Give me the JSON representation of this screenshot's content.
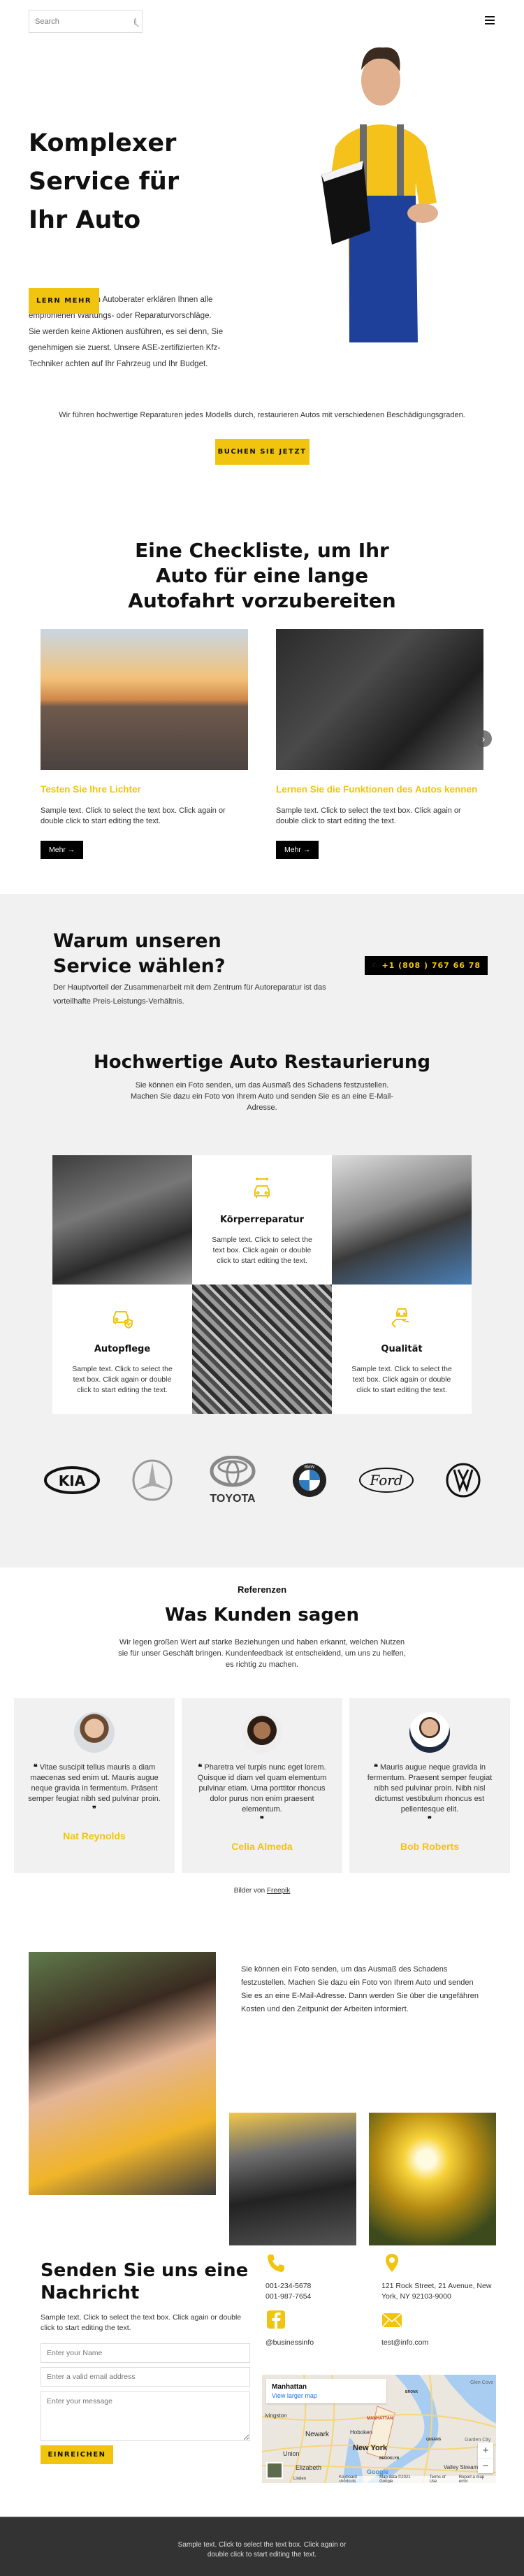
{
  "header": {
    "search_placeholder": "Search",
    "search_icon": "search-icon",
    "menu_icon": "hamburger-icon"
  },
  "hero": {
    "title": "Komplexer Service für Ihr Auto",
    "description": "Unsere freundlichen Autoberater erklären Ihnen alle empfohlenen Wartungs- oder Reparaturvorschläge. Sie werden keine Aktionen ausführen, es sei denn, Sie genehmigen sie zuerst. Unsere ASE-zertifizierten Kfz-Techniker achten auf Ihr Fahrzeug und Ihr Budget.",
    "button": "LERN MEHR"
  },
  "intro": {
    "text": "Wir führen hochwertige Reparaturen jedes Modells durch, restaurieren Autos mit verschiedenen Beschädigungsgraden.",
    "button": "BUCHEN SIE JETZT"
  },
  "checklist": {
    "title": "Eine Checkliste, um Ihr Auto für eine lange Autofahrt vorzubereiten",
    "cards": [
      {
        "title": "Testen Sie Ihre Lichter",
        "text": "Sample text. Click to select the text box. Click again or double click to start editing the text.",
        "button": "Mehr →"
      },
      {
        "title": "Lernen Sie die Funktionen des Autos kennen",
        "text": "Sample text. Click to select the text box. Click again or double click to start editing the text.",
        "button": "Mehr →"
      }
    ],
    "next_icon": "chevron-right-icon"
  },
  "why": {
    "title": "Warum unseren Service wählen?",
    "text": "Der Hauptvorteil der Zusammenarbeit mit dem Zentrum für Autoreparatur ist das vorteilhafte Preis-Leistungs-Verhältnis.",
    "phone": "+1 (808 ) 767 66 78"
  },
  "restoration": {
    "title": "Hochwertige Auto Restaurierung",
    "subtitle": "Sie können ein Foto senden, um das Ausmaß des Schadens festzustellen. Machen Sie dazu ein Foto von Ihrem Auto und senden Sie es an eine E-Mail-Adresse.",
    "features": [
      {
        "title": "Körperreparatur",
        "text": "Sample text. Click to select the text box. Click again or double click to start editing the text.",
        "icon": "car-wrench-icon"
      },
      {
        "title": "Autopflege",
        "text": "Sample text. Click to select the text box. Click again or double click to start editing the text.",
        "icon": "car-shield-icon"
      },
      {
        "title": "Qualität",
        "text": "Sample text. Click to select the text box. Click again or double click to start editing the text.",
        "icon": "hand-car-icon"
      }
    ]
  },
  "brands": [
    "KIA",
    "Mercedes-Benz",
    "TOYOTA",
    "BMW",
    "Ford",
    "Volkswagen"
  ],
  "testimonials": {
    "kicker": "Referenzen",
    "title": "Was Kunden sagen",
    "subtitle": "Wir legen großen Wert auf starke Beziehungen und haben erkannt, welchen Nutzen sie für unser Geschäft bringen. Kundenfeedback ist entscheidend, um uns zu helfen, es richtig zu machen.",
    "items": [
      {
        "quote": "Vitae suscipit tellus mauris a diam maecenas sed enim ut. Mauris augue neque gravida in fermentum. Präsent semper feugiat nibh sed pulvinar proin.",
        "name": "Nat Reynolds"
      },
      {
        "quote": "Pharetra vel turpis nunc eget lorem. Quisque id diam vel quam elementum pulvinar etiam. Urna porttitor rhoncus dolor purus non enim praesent elementum.",
        "name": "Celia Almeda"
      },
      {
        "quote": "Mauris augue neque gravida in fermentum. Praesent semper feugiat nibh sed pulvinar proin. Nibh nisl dictumst vestibulum rhoncus est pellentesque elit.",
        "name": "Bob Roberts"
      }
    ],
    "open_quote": "❝",
    "close_quote": "❞",
    "credits_prefix": "Bilder von",
    "credits_link": "Freepik"
  },
  "gallery": {
    "text": "Sie können ein Foto senden, um das Ausmaß des Schadens festzustellen. Machen Sie dazu ein Foto von Ihrem Auto und senden Sie es an eine E-Mail-Adresse. Dann werden Sie über die ungefähren Kosten und den Zeitpunkt der Arbeiten informiert."
  },
  "contact": {
    "title": "Senden Sie uns eine Nachricht",
    "description": "Sample text. Click to select the text box. Click again or double click to start editing the text.",
    "name_placeholder": "Enter your Name",
    "email_placeholder": "Enter a valid email address",
    "message_placeholder": "Enter your message",
    "submit": "EINREICHEN",
    "phone_lines": "001-234-5678\n001-987-7654",
    "address": "121 Rock Street, 21 Avenue, New York, NY 92103-9000",
    "facebook": "@businessinfo",
    "email": "test@info.com",
    "accent": "#f1c40f"
  },
  "map": {
    "place": "Manhattan",
    "larger_link": "View larger map",
    "labels": {
      "newyork": "New York",
      "newark": "Newark",
      "hoboken": "Hoboken",
      "union": "Union",
      "elizabeth": "Elizabeth",
      "brooklyn": "BROOKLYN",
      "queens": "QUEENS",
      "bronx": "BRONX",
      "manhattan": "MANHATTAN",
      "glencove": "Glen Cove",
      "valleystream": "Valley Stream",
      "gardencity": "Garden City",
      "livingston": "ivingston",
      "linden": "Linden"
    },
    "google": "Google",
    "footer": [
      "Keyboard shortcuts",
      "Map data ©2021 Google",
      "Terms of Use",
      "Report a map error"
    ],
    "zoom_in": "+",
    "zoom_out": "−"
  },
  "footer": {
    "text": "Sample text. Click to select the text box. Click again or double click to start editing the text."
  }
}
